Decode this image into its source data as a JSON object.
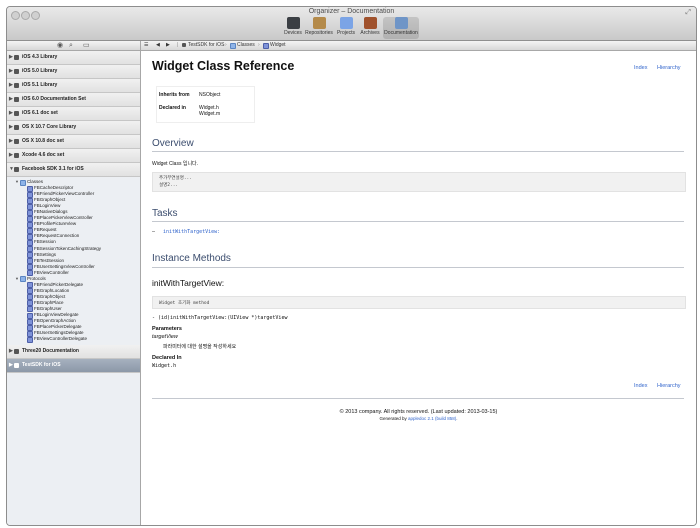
{
  "window": {
    "title": "Organizer – Documentation"
  },
  "toolbar": {
    "items": [
      {
        "label": "Devices",
        "icon": "devices-icon",
        "color": "#3b3f44"
      },
      {
        "label": "Repositories",
        "icon": "repositories-icon",
        "color": "#b48a4a"
      },
      {
        "label": "Projects",
        "icon": "projects-icon",
        "color": "#7ba4e6"
      },
      {
        "label": "Archives",
        "icon": "archives-icon",
        "color": "#a0522d"
      },
      {
        "label": "Documentation",
        "icon": "documentation-icon",
        "color": "#6f95c7"
      }
    ]
  },
  "sidebar": {
    "controls": [
      "eye-icon",
      "search-icon",
      "book-icon"
    ],
    "libraries_before": [
      "iOS 4.3 Library",
      "iOS 5.0 Library",
      "iOS 5.1 Library",
      "iOS 6.0 Documentation Set",
      "iOS 6.1 doc set",
      "OS X 10.7 Core Library",
      "OS X 10.8 doc set",
      "Xcode 4.6 doc set"
    ],
    "expanded_library": "Facebook SDK 3.1 for iOS",
    "classes_group": "Classes",
    "classes": [
      "FBCacheDescriptor",
      "FBFriendPickerViewController",
      "FBGraphObject",
      "FBLoginView",
      "FBNativeDialogs",
      "FBPlacePickerViewController",
      "FBProfilePictureView",
      "FBRequest",
      "FBRequestConnection",
      "FBSession",
      "FBSessionTokenCachingStrategy",
      "FBSettings",
      "FBTestSession",
      "FBUserSettingsViewController",
      "FBViewController"
    ],
    "protocols_group": "Protocols",
    "protocols": [
      "FBFriendPickerDelegate",
      "FBGraphLocation",
      "FBGraphObject",
      "FBGraphPlace",
      "FBGraphUser",
      "FBLoginViewDelegate",
      "FBOpenGraphAction",
      "FBPlacePickerDelegate",
      "FBUserSettingsDelegate",
      "FBViewControllerDelegate"
    ],
    "libraries_after": [
      {
        "label": "Three20 Documentation",
        "selected": false
      },
      {
        "label": "TestSDK for iOS",
        "selected": true
      }
    ]
  },
  "pathbar": {
    "nav": [
      "list-icon",
      "back-icon",
      "forward-icon"
    ],
    "crumbs": [
      "TestSDK for iOS",
      "Classes",
      "Widget"
    ]
  },
  "doc": {
    "title": "Widget Class Reference",
    "index_link": "Index",
    "hierarchy_link": "Hierarchy",
    "inherits_label": "Inherits from",
    "inherits_value": "NSObject",
    "declared_label": "Declared in",
    "declared_value_1": "Widget.h",
    "declared_value_2": "Widget.m",
    "overview_heading": "Overview",
    "overview_text": "Widget Class 입니다.",
    "overview_code_1": "추가부연설명...",
    "overview_code_2": "설명2...",
    "tasks_heading": "Tasks",
    "tasks_bullet": "–",
    "tasks_item": "initWithTargetView:",
    "instance_heading": "Instance Methods",
    "method_title": "initWithTargetView:",
    "method_desc_code": "Widget 초기화 method",
    "method_signature": "- (id)initWithTargetView:(UIView *)targetView",
    "parameters_label": "Parameters",
    "param_name": "targetView",
    "param_desc": "파라미터에 대한 설명을 작성하세요",
    "declared_in_label": "Declared In",
    "declared_in_value": "Widget.h",
    "bottom_index_link": "Index",
    "bottom_hierarchy_link": "Hierarchy",
    "footer_copyright": "© 2013 company. All rights reserved. (Last updated: 2013-03-15)",
    "footer_generated_prefix": "Generated by",
    "footer_generated_link": "appledoc 2.1 (build 858)",
    "footer_generated_suffix": "."
  }
}
